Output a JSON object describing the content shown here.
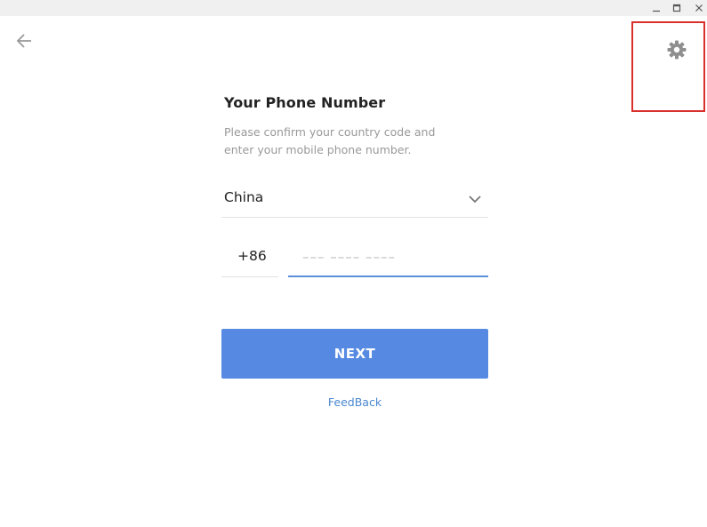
{
  "window": {
    "minimize_icon": "minimize-icon",
    "maximize_icon": "maximize-icon",
    "close_icon": "close-icon"
  },
  "nav": {
    "back_icon": "arrow-left-icon",
    "settings_icon": "gear-icon",
    "highlight_color": "#d9302c"
  },
  "form": {
    "title": "Your Phone Number",
    "description": "Please confirm your country code and enter your mobile phone number.",
    "country": {
      "selected": "China",
      "dropdown_icon": "chevron-down-icon"
    },
    "country_code": "+86",
    "phone": {
      "value": "",
      "placeholder": "––– –––– ––––"
    },
    "next_button": "NEXT",
    "feedback_link": "FeedBack"
  },
  "colors": {
    "accent": "#568ae2",
    "link": "#4a88d1",
    "input_underline": "#5b8fd9"
  }
}
